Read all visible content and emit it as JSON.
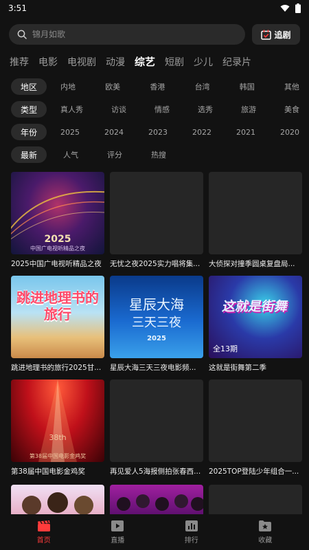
{
  "status": {
    "time": "3:51"
  },
  "search": {
    "placeholder": "锦月如歌",
    "follow_label": "追剧"
  },
  "tabs": [
    "推荐",
    "电影",
    "电视剧",
    "动漫",
    "综艺",
    "短剧",
    "少儿",
    "纪录片"
  ],
  "active_tab": "综艺",
  "filters": [
    {
      "label": "地区",
      "options": [
        "内地",
        "欧美",
        "香港",
        "台湾",
        "韩国",
        "其他"
      ]
    },
    {
      "label": "类型",
      "options": [
        "真人秀",
        "访谈",
        "情感",
        "选秀",
        "旅游",
        "美食"
      ]
    },
    {
      "label": "年份",
      "options": [
        "2025",
        "2024",
        "2023",
        "2022",
        "2021",
        "2020"
      ]
    },
    {
      "label": "最新",
      "options": [
        "人气",
        "评分",
        "热搜"
      ]
    }
  ],
  "cards": [
    {
      "title": "2025中国广电视听精品之夜",
      "thumb_text": "2025",
      "thumb_sub": "中国广电视听精品之夜"
    },
    {
      "title": "无忧之夜2025实力唱将集..."
    },
    {
      "title": "大侦探对撞季圆桌复盘局..."
    },
    {
      "title": "跳进地理书的旅行2025甘...",
      "thumb_text": "跳进地理书的旅行"
    },
    {
      "title": "星辰大海三天三夜电影频...",
      "thumb_text": "星辰大海",
      "thumb_sub": "三天三夜",
      "thumb_year": "2025"
    },
    {
      "title": "这就是街舞第二季",
      "thumb_text": "这就是街舞",
      "badge": "全13期"
    },
    {
      "title": "第38届中国电影金鸡奖",
      "thumb_text": "38th",
      "thumb_sub": "第38届中国电影金鸡奖"
    },
    {
      "title": "再见爱人5海报侧拍张春西..."
    },
    {
      "title": "2025TOP登陆少年组合一..."
    }
  ],
  "nav": [
    {
      "label": "首页",
      "icon": "clapper-icon"
    },
    {
      "label": "直播",
      "icon": "play-icon"
    },
    {
      "label": "排行",
      "icon": "chart-icon"
    },
    {
      "label": "收藏",
      "icon": "star-box-icon"
    }
  ],
  "colors": {
    "accent": "#ff3b3b",
    "background": "#121212",
    "chip": "#2b2b2b"
  }
}
